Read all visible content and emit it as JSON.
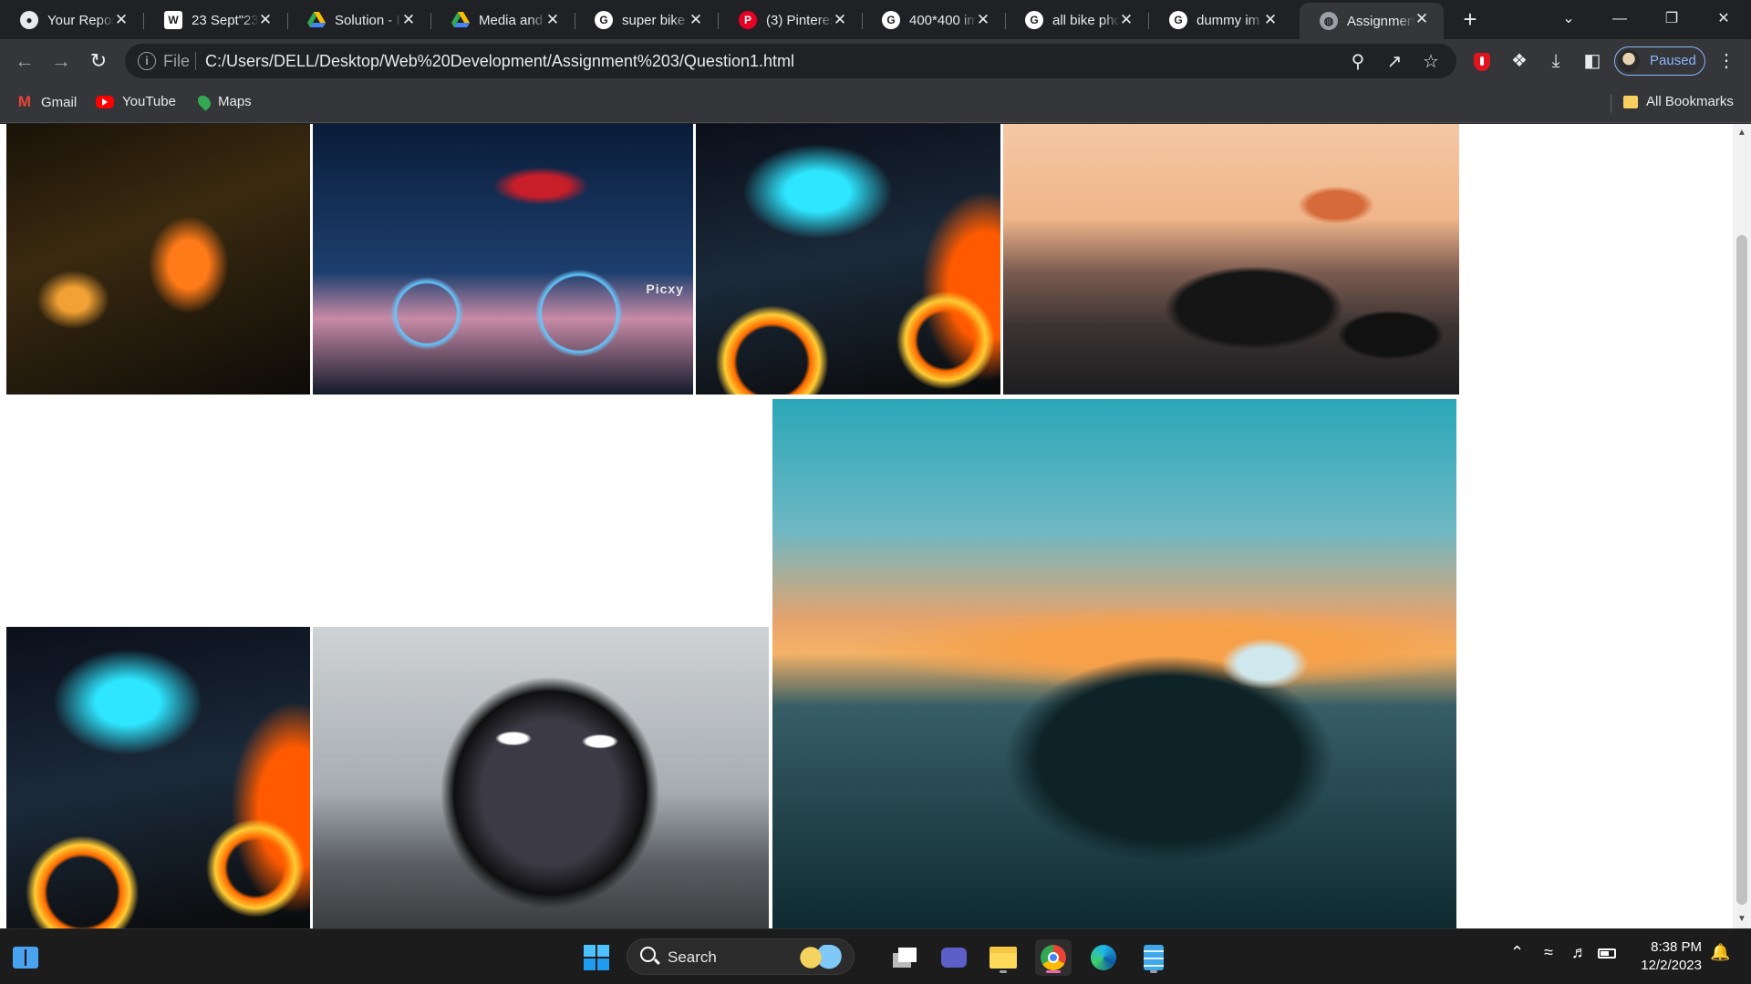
{
  "browser": {
    "tabs": [
      {
        "title": "Your Repos",
        "favicon": "github-icon",
        "active": false
      },
      {
        "title": "23 Sept\"23",
        "favicon": "wordpress-icon",
        "active": false
      },
      {
        "title": "Solution - I",
        "favicon": "google-drive-icon",
        "active": false
      },
      {
        "title": "Media and",
        "favicon": "google-drive-icon",
        "active": false
      },
      {
        "title": "super bike",
        "favicon": "google-icon",
        "active": false
      },
      {
        "title": "(3) Pinterest",
        "favicon": "pinterest-icon",
        "active": false
      },
      {
        "title": "400*400 im",
        "favicon": "google-icon",
        "active": false
      },
      {
        "title": "all bike pho",
        "favicon": "google-icon",
        "active": false
      },
      {
        "title": "dummy im",
        "favicon": "google-icon",
        "active": false
      },
      {
        "title": "Assignment",
        "favicon": "globe-icon",
        "active": true
      }
    ],
    "close_glyph": "✕",
    "new_tab_glyph": "+",
    "address_bar": {
      "scheme_label": "File",
      "url": "C:/Users/DELL/Desktop/Web%20Development/Assignment%203/Question1.html"
    },
    "profile_status": "Paused",
    "bookmarks": [
      {
        "label": "Gmail",
        "icon": "gmail-icon"
      },
      {
        "label": "YouTube",
        "icon": "youtube-icon"
      },
      {
        "label": "Maps",
        "icon": "maps-icon"
      }
    ],
    "all_bookmarks_label": "All Bookmarks"
  },
  "page": {
    "images": [
      {
        "name": "neon-motorbike-night-ride",
        "palette": [
          "#1a1208",
          "#f2a134",
          "#ff7a18"
        ]
      },
      {
        "name": "blue-neon-motorbike-rider",
        "palette": [
          "#0b1e3a",
          "#2f6fb0",
          "#62c7ff"
        ],
        "watermark": "Picxy"
      },
      {
        "name": "fiery-cyber-motorbike",
        "palette": [
          "#102a3a",
          "#ff6a00",
          "#2ee6ff"
        ]
      },
      {
        "name": "naked-bike-sunset-road",
        "palette": [
          "#f0b58a",
          "#5a4a44",
          "#1d1d1f"
        ]
      },
      {
        "name": "fiery-cyber-motorbike-repeat",
        "palette": [
          "#102a3a",
          "#ff6a00",
          "#2ee6ff"
        ]
      },
      {
        "name": "black-sportbike-front",
        "palette": [
          "#cfd3d6",
          "#3c3a44",
          "#121214"
        ]
      },
      {
        "name": "motorbike-tree-sunset",
        "palette": [
          "#2aa7b8",
          "#f6a14a",
          "#0f2a31"
        ]
      }
    ]
  },
  "taskbar": {
    "search_label": "Search",
    "clock_time": "8:38 PM",
    "clock_date": "12/2/2023"
  }
}
